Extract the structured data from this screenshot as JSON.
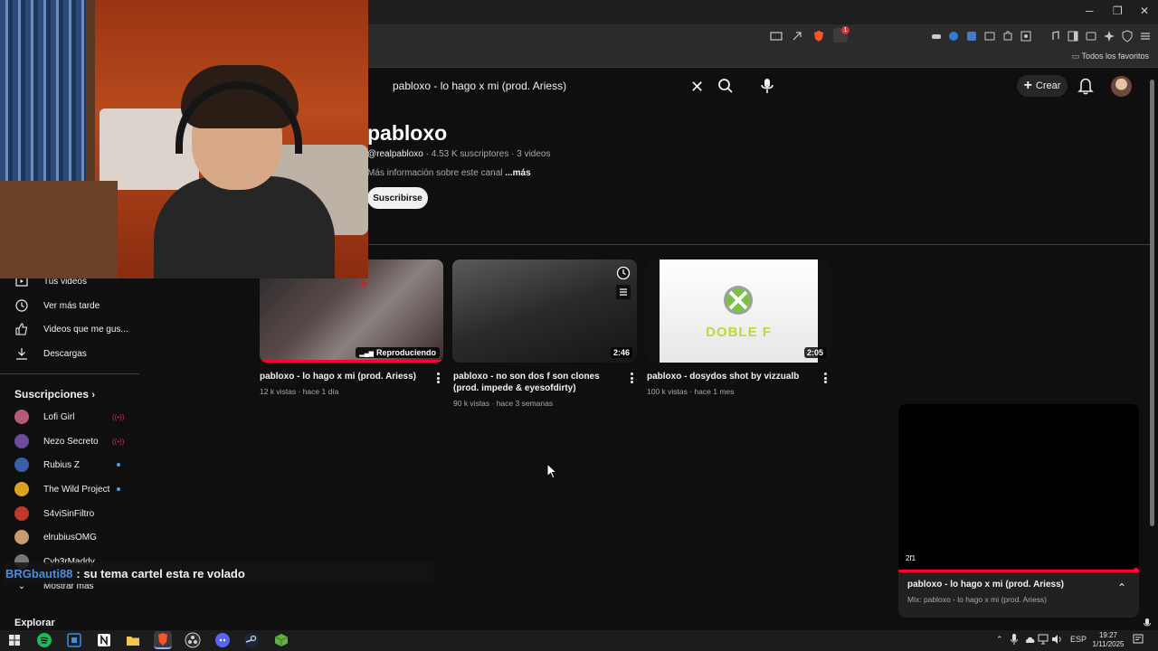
{
  "browser": {
    "bookmarks_folder": "Todos los favoritos",
    "brave_badge": "1",
    "window_controls": [
      "─",
      "❐",
      "✕"
    ]
  },
  "header": {
    "search_query": "pabloxo - lo hago x mi (prod. Ariess)",
    "create_label": "Crear"
  },
  "channel": {
    "name": "pabloxo",
    "handle": "@realpabloxo",
    "stats": " · 4.53 K suscriptores · 3 videos",
    "more_info": "Más información sobre este canal ",
    "more_link": "...más",
    "subscribe_label": "Suscribirse"
  },
  "videos": [
    {
      "title": "pabloxo - lo hago x mi (prod. Ariess)",
      "meta": "12 k vistas · hace 1 día",
      "badge": "Reproduciendo",
      "badge_icon": "▂▄▆"
    },
    {
      "title": "pabloxo - no son dos f son clones (prod. impede & eyesofdirty)",
      "meta": "90 k vistas · hace 3 semanas",
      "duration": "2:46"
    },
    {
      "title": "pabloxo - dosydos shot by vizzualb",
      "meta": "100 k vistas · hace 1 mes",
      "duration": "2:05",
      "thumb_text": "DOBLE F"
    }
  ],
  "sidebar": {
    "items": [
      {
        "label": "Tus videos",
        "icon": "your-videos-icon"
      },
      {
        "label": "Ver más tarde",
        "icon": "clock-icon"
      },
      {
        "label": "Videos que me gus...",
        "icon": "thumbs-up-icon"
      },
      {
        "label": "Descargas",
        "icon": "download-icon"
      }
    ],
    "subscriptions_header": "Suscripciones",
    "subscriptions": [
      {
        "name": "Lofi Girl",
        "indicator": "live",
        "color": "#b5597a"
      },
      {
        "name": "Nezo Secreto",
        "indicator": "live",
        "color": "#6b4b9c"
      },
      {
        "name": "Rubius Z",
        "indicator": "dot",
        "color": "#3a5ea8"
      },
      {
        "name": "The Wild Project",
        "indicator": "dot",
        "color": "#d9a320"
      },
      {
        "name": "S4viSinFiltro",
        "indicator": "",
        "color": "#c0392b"
      },
      {
        "name": "elrubiusOMG",
        "indicator": "",
        "color": "#c89b6d"
      },
      {
        "name": "Cyb3rMaddy",
        "indicator": "",
        "color": "#777777"
      }
    ],
    "show_more": "Mostrar más",
    "explore": "Explorar",
    "live_glyph": "((•))"
  },
  "chat": {
    "user": "BRGbauti88",
    "message": ": su tema cartel esta re volado"
  },
  "miniplayer": {
    "title": "pabloxo - lo hago x mi (prod. Ariess)",
    "subtitle": "Mix: pabloxo - lo hago x mi (prod. Ariess)",
    "logo_text": "2f1"
  },
  "taskbar": {
    "language": "ESP",
    "time": "19:27",
    "date": "1/11/2025"
  }
}
